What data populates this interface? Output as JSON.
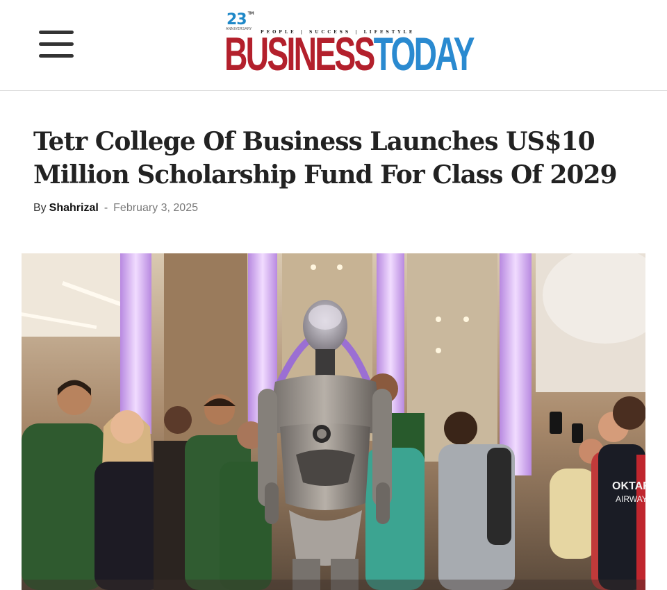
{
  "header": {
    "logo": {
      "anniversary": "23",
      "anniversary_sub": "ANNIVERSARY",
      "tagline": "PEOPLE | SUCCESS | LIFESTYLE",
      "business": "BUSINESS",
      "today": "TODAY"
    },
    "menu_icon": "hamburger-icon"
  },
  "article": {
    "title": "Tetr College Of Business Launches US$10 Million Scholarship Fund For Class Of 2029",
    "by_label": "By",
    "author": "Shahrizal",
    "separator": "-",
    "date": "February 3, 2025",
    "hero_shirt_text_1": "OKTAR",
    "hero_shirt_text_2": "AIRWAYS"
  },
  "colors": {
    "brand_red": "#b3202c",
    "brand_blue": "#2a8ad0",
    "text_dark": "#222222",
    "date_gray": "#7a7a7a"
  }
}
